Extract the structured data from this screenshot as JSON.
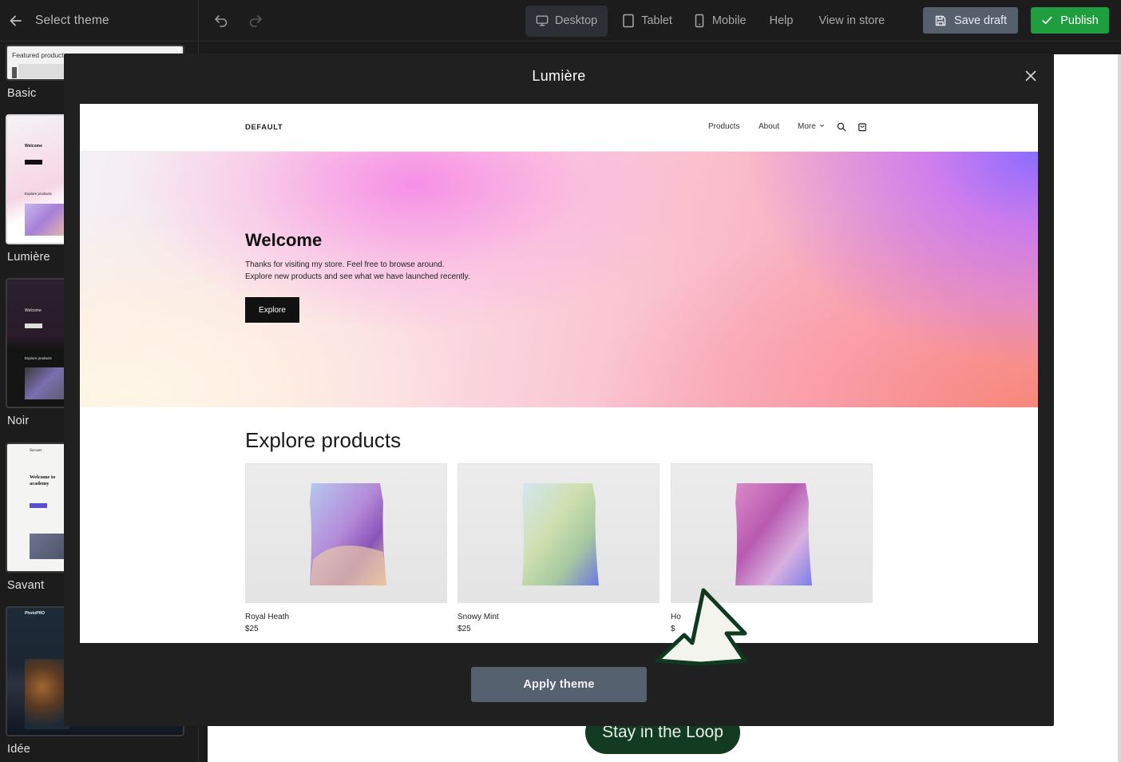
{
  "topbar": {
    "back_label": "Select theme",
    "views": [
      {
        "label": "Desktop",
        "active": true
      },
      {
        "label": "Tablet",
        "active": false
      },
      {
        "label": "Mobile",
        "active": false
      }
    ],
    "help_label": "Help",
    "view_store_label": "View in store",
    "save_draft_label": "Save draft",
    "publish_label": "Publish"
  },
  "sidebar": {
    "themes": [
      {
        "name": "Basic",
        "preview_label": "Featured products"
      },
      {
        "name": "Lumière",
        "preview_label": "Welcome",
        "preview_sub": "Explore products",
        "selected": true
      },
      {
        "name": "Noir",
        "preview_label": "Welcome",
        "preview_sub": "Explore products"
      },
      {
        "name": "Savant",
        "preview_brand": "Savant",
        "preview_label": "Welcome to academy"
      },
      {
        "name": "Idée",
        "preview_brand": "PhotoPRO"
      }
    ]
  },
  "canvas": {
    "cta_label": "Stay in the Loop"
  },
  "modal": {
    "title": "Lumière",
    "apply_label": "Apply theme",
    "preview": {
      "logo": "DEFAULT",
      "nav": [
        "Products",
        "About",
        "More"
      ],
      "hero_title": "Welcome",
      "hero_text_1": "Thanks for visiting my store. Feel free to browse around.",
      "hero_text_2": "Explore new products and see what we have launched recently.",
      "hero_button": "Explore",
      "section_title": "Explore products",
      "products": [
        {
          "name": "Royal Heath",
          "price": "$25"
        },
        {
          "name": "Snowy Mint",
          "price": "$25"
        },
        {
          "name": "Ho",
          "price": "$"
        }
      ]
    }
  },
  "colors": {
    "publish": "#1f9e3f",
    "save_draft": "#56606d",
    "apply_button": "#566170",
    "cta_pill": "#123b21"
  }
}
